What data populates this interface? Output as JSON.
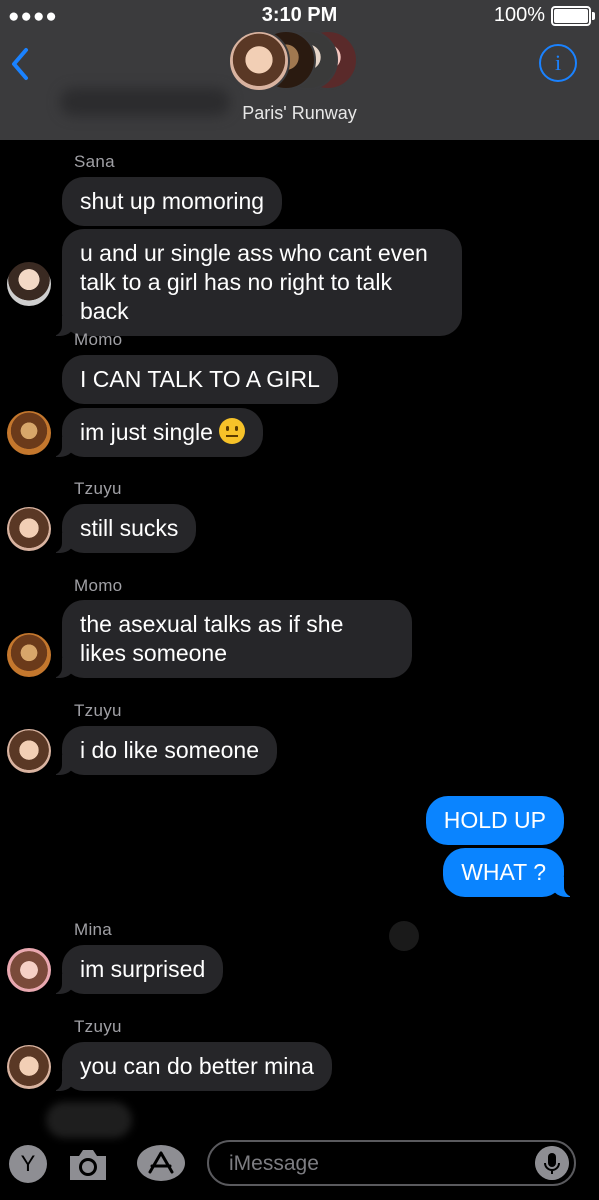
{
  "status": {
    "signal": "●●●●",
    "time": "3:10 PM",
    "battery": "100%"
  },
  "header": {
    "group_name": "Paris' Runway"
  },
  "messages": [
    {
      "sender": "Sana",
      "texts": [
        "shut up momoring",
        "u and ur single ass who cant even talk to a girl has no right to talk back"
      ]
    },
    {
      "sender": "Momo",
      "texts": [
        "I CAN TALK TO A GIRL",
        "im just single"
      ]
    },
    {
      "sender": "Tzuyu",
      "texts": [
        "still sucks"
      ]
    },
    {
      "sender": "Momo",
      "texts": [
        "the asexual talks as if she likes someone"
      ]
    },
    {
      "sender": "Tzuyu",
      "texts": [
        "i do like someone"
      ]
    },
    {
      "sender": "me",
      "texts": [
        "HOLD UP",
        "WHAT ?"
      ]
    },
    {
      "sender": "Mina",
      "texts": [
        "im surprised"
      ]
    },
    {
      "sender": "Tzuyu",
      "texts": [
        "you can do better mina"
      ]
    }
  ],
  "composer": {
    "apps_button": "Y",
    "placeholder": "iMessage"
  },
  "colors": {
    "header_bg": "#3b3b3d",
    "incoming_bubble": "#262629",
    "outgoing_bubble": "#0a84ff",
    "accent": "#1a82ff"
  },
  "icons": [
    "back-chevron-icon",
    "info-icon",
    "emoji-neutral-face",
    "camera-icon",
    "app-store-icon",
    "microphone-icon"
  ]
}
